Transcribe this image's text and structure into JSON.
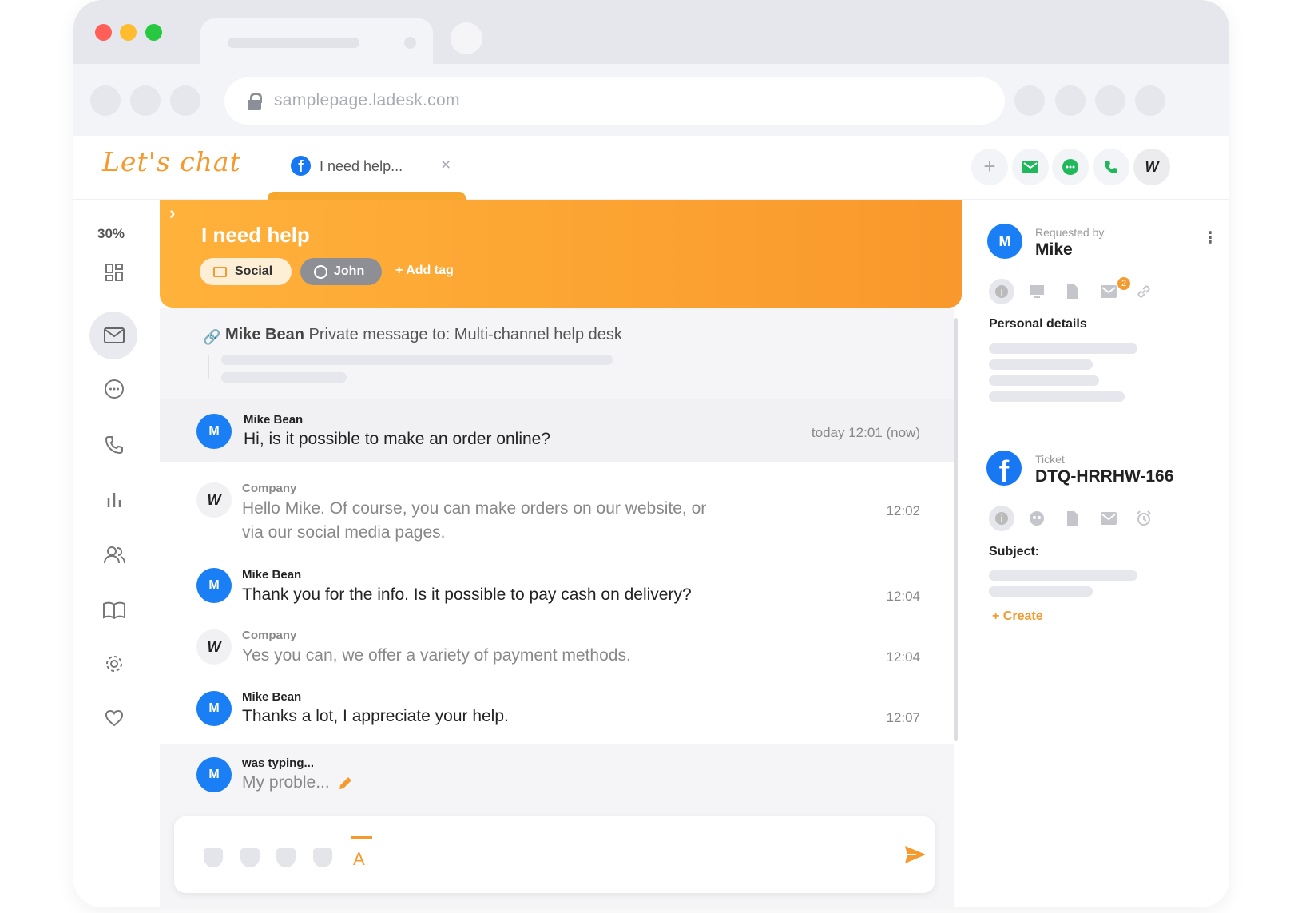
{
  "browser": {
    "url": "samplepage.ladesk.com"
  },
  "app": {
    "logo": "Let's chat",
    "tab_title": "I need help...",
    "tab_close": "×"
  },
  "sidebar": {
    "percent": "30%"
  },
  "ticket": {
    "title": "I need help",
    "tags": [
      "Social",
      "John"
    ],
    "add_tag": "+ Add tag",
    "private_sender": "Mike Bean",
    "private_text": "Private message to:  Multi-channel help desk"
  },
  "messages": [
    {
      "sender": "Mike Bean",
      "avatar": "M",
      "text": "Hi, is it possible to make an order online?",
      "time": "today 12:01 (now)"
    },
    {
      "sender": "Company",
      "avatar": "W",
      "text": "Hello Mike. Of course, you can make orders on our website, or via our social media pages.",
      "time": "12:02"
    },
    {
      "sender": "Mike Bean",
      "avatar": "M",
      "text": "Thank you for the info. Is it possible to pay cash on delivery?",
      "time": "12:04"
    },
    {
      "sender": "Company",
      "avatar": "W",
      "text": "Yes you can, we offer a variety of payment methods.",
      "time": "12:04"
    },
    {
      "sender": "Mike Bean",
      "avatar": "M",
      "text": "Thanks a lot, I appreciate your help.",
      "time": "12:07"
    }
  ],
  "typing": {
    "label": "was typing...",
    "avatar": "M",
    "text": "My proble..."
  },
  "composer": {
    "format_label": "A"
  },
  "right": {
    "requested_by": "Requested by",
    "requester": "Mike",
    "requester_avatar": "M",
    "badge": "2",
    "personal_details": "Personal details",
    "ticket_label": "Ticket",
    "ticket_id": "DTQ-HRRHW-166",
    "subject": "Subject:",
    "create": "+ Create"
  },
  "colors": {
    "accent": "#f49a2e",
    "blue": "#1a7ff5",
    "green": "#1fb85a"
  }
}
